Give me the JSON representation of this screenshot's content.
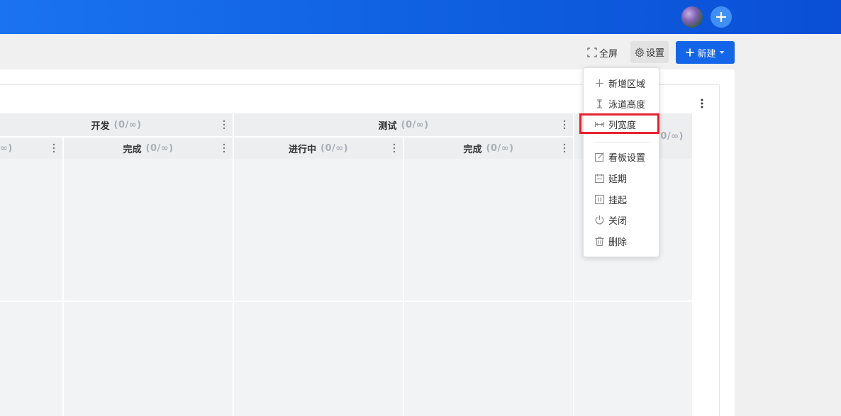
{
  "header": {
    "avatar_icon": "user-avatar",
    "add_icon": "plus-circle-icon"
  },
  "toolbar": {
    "fullscreen_label": "全屏",
    "settings_label": "设置",
    "new_label": "新建"
  },
  "board": {
    "groups": [
      {
        "name": "开发",
        "count": "(0/∞)"
      },
      {
        "name": "测试",
        "count": "(0/∞)"
      }
    ],
    "partial_left_count": "∞)",
    "partial_right_count": "0/∞)",
    "columns": [
      {
        "name": "完成",
        "count": "(0/∞)"
      },
      {
        "name": "进行中",
        "count": "(0/∞)"
      },
      {
        "name": "完成",
        "count": "(0/∞)"
      }
    ]
  },
  "settings_menu": {
    "items": [
      {
        "label": "新增区域",
        "icon": "plus-icon"
      },
      {
        "label": "泳道高度",
        "icon": "row-height-icon"
      },
      {
        "label": "列宽度",
        "icon": "column-width-icon"
      },
      {
        "label": "看板设置",
        "icon": "edit-icon"
      },
      {
        "label": "延期",
        "icon": "calendar-icon"
      },
      {
        "label": "挂起",
        "icon": "pause-icon"
      },
      {
        "label": "关闭",
        "icon": "power-icon"
      },
      {
        "label": "删除",
        "icon": "trash-icon"
      }
    ],
    "highlight_color": "#e5222f"
  },
  "colors": {
    "topbar": "#1565e8",
    "primary_button": "#1565e8"
  }
}
